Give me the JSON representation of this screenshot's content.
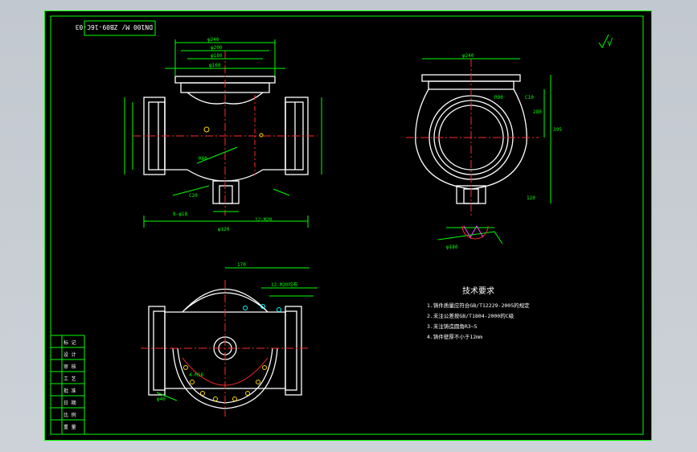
{
  "drawing": {
    "number_stamp": "DN100 M/ ZB09-16C-03",
    "roughness_symbol": "√",
    "tech_requirements": {
      "title": "技术要求",
      "items": [
        "1.铸件质量应符合GB/T12229-2005的规定",
        "2.未注公差按GB/T1804-2000的C级",
        "3.未注铸造圆角R3~5",
        "4.铸件壁厚不小于12mm"
      ]
    },
    "title_block": {
      "rows": [
        "标 记",
        "设 计",
        "审 核",
        "工 艺",
        "批 准",
        "日 期",
        "比 例",
        "重 量"
      ]
    },
    "dims_front": [
      "φ240",
      "φ200",
      "φ180",
      "φ160",
      "8-φ18",
      "12-M20",
      "R60",
      "φ120",
      "C20"
    ],
    "dims_side": [
      "φ240",
      "φ180",
      "R90",
      "C10",
      "395",
      "280",
      "120"
    ],
    "dims_plan": [
      "170",
      "12-M20均布",
      "4-M16",
      "φ40"
    ]
  }
}
